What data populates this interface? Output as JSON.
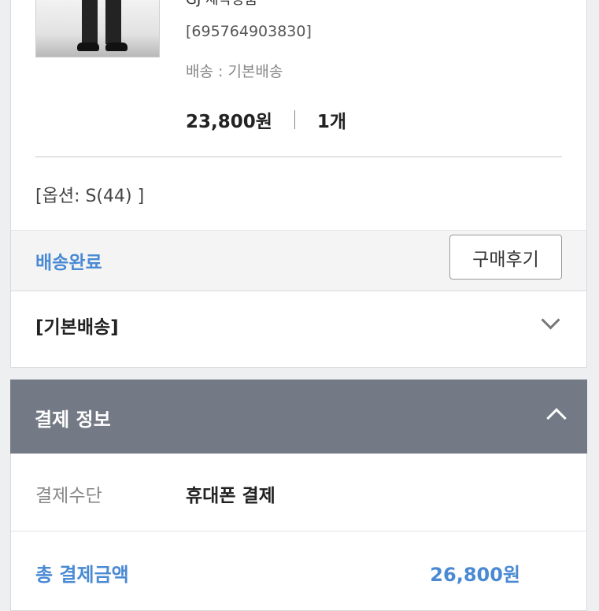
{
  "order": {
    "product_name_partial": "GJ 제작상품",
    "product_code": "[695764903830]",
    "shipping_label": "배송 : 기본배송",
    "price": "23,800원",
    "quantity": "1개",
    "option": "[옵션: S(44) ]",
    "status": "배송완료",
    "review_button": "구매후기",
    "shipping_type": "[기본배송]"
  },
  "payment": {
    "section_title": "결제 정보",
    "method_label": "결제수단",
    "method_value": "휴대폰 결제",
    "total_label": "총 결제금액",
    "total_value": "26,800원"
  },
  "icons": {
    "shipping_toggle": "chevron-down-icon",
    "payment_toggle": "chevron-up-icon"
  },
  "colors": {
    "accent_blue": "#4a8ad4",
    "header_gray": "#747a85"
  }
}
